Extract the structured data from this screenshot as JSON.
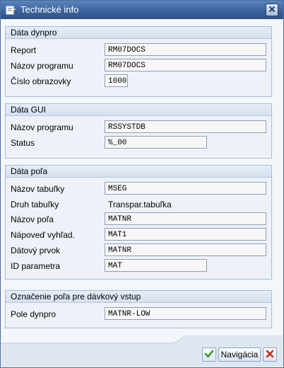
{
  "window": {
    "title": "Technické info",
    "title_icon": "document-edit-icon",
    "close_icon": "close-icon"
  },
  "sections": {
    "dynpro": {
      "heading": "Dáta dynpro",
      "report_label": "Report",
      "report_value": "RM07DOCS",
      "program_label": "Názov programu",
      "program_value": "RM07DOCS",
      "screen_label": "Číslo obrazovky",
      "screen_value": "1000"
    },
    "gui": {
      "heading": "Dáta GUI",
      "program_label": "Názov programu",
      "program_value": "RSSYSTDB",
      "status_label": "Status",
      "status_value": "%_00"
    },
    "field": {
      "heading": "Dáta poľa",
      "table_label": "Názov tabuľky",
      "table_value": "MSEG",
      "type_label": "Druh tabuľky",
      "type_value": "Transpar.tabuľka",
      "name_label": "Názov poľa",
      "name_value": "MATNR",
      "help_label": "Nápoveď vyhľad.",
      "help_value": "MAT1",
      "element_label": "Dátový prvok",
      "element_value": "MATNR",
      "param_label": "ID parametra",
      "param_value": "MAT"
    },
    "batch": {
      "heading": "Označenie poľa pre dávkový vstup",
      "dynpro_label": "Pole dynpro",
      "dynpro_value": "MATNR-LOW"
    }
  },
  "footer": {
    "ok_icon": "checkmark-icon",
    "nav_label": "Navigácia",
    "cancel_icon": "cancel-x-icon"
  },
  "colors": {
    "title_bar": "#3b6099",
    "ok_green": "#3a9a1c",
    "cancel_red": "#d22a1a"
  }
}
